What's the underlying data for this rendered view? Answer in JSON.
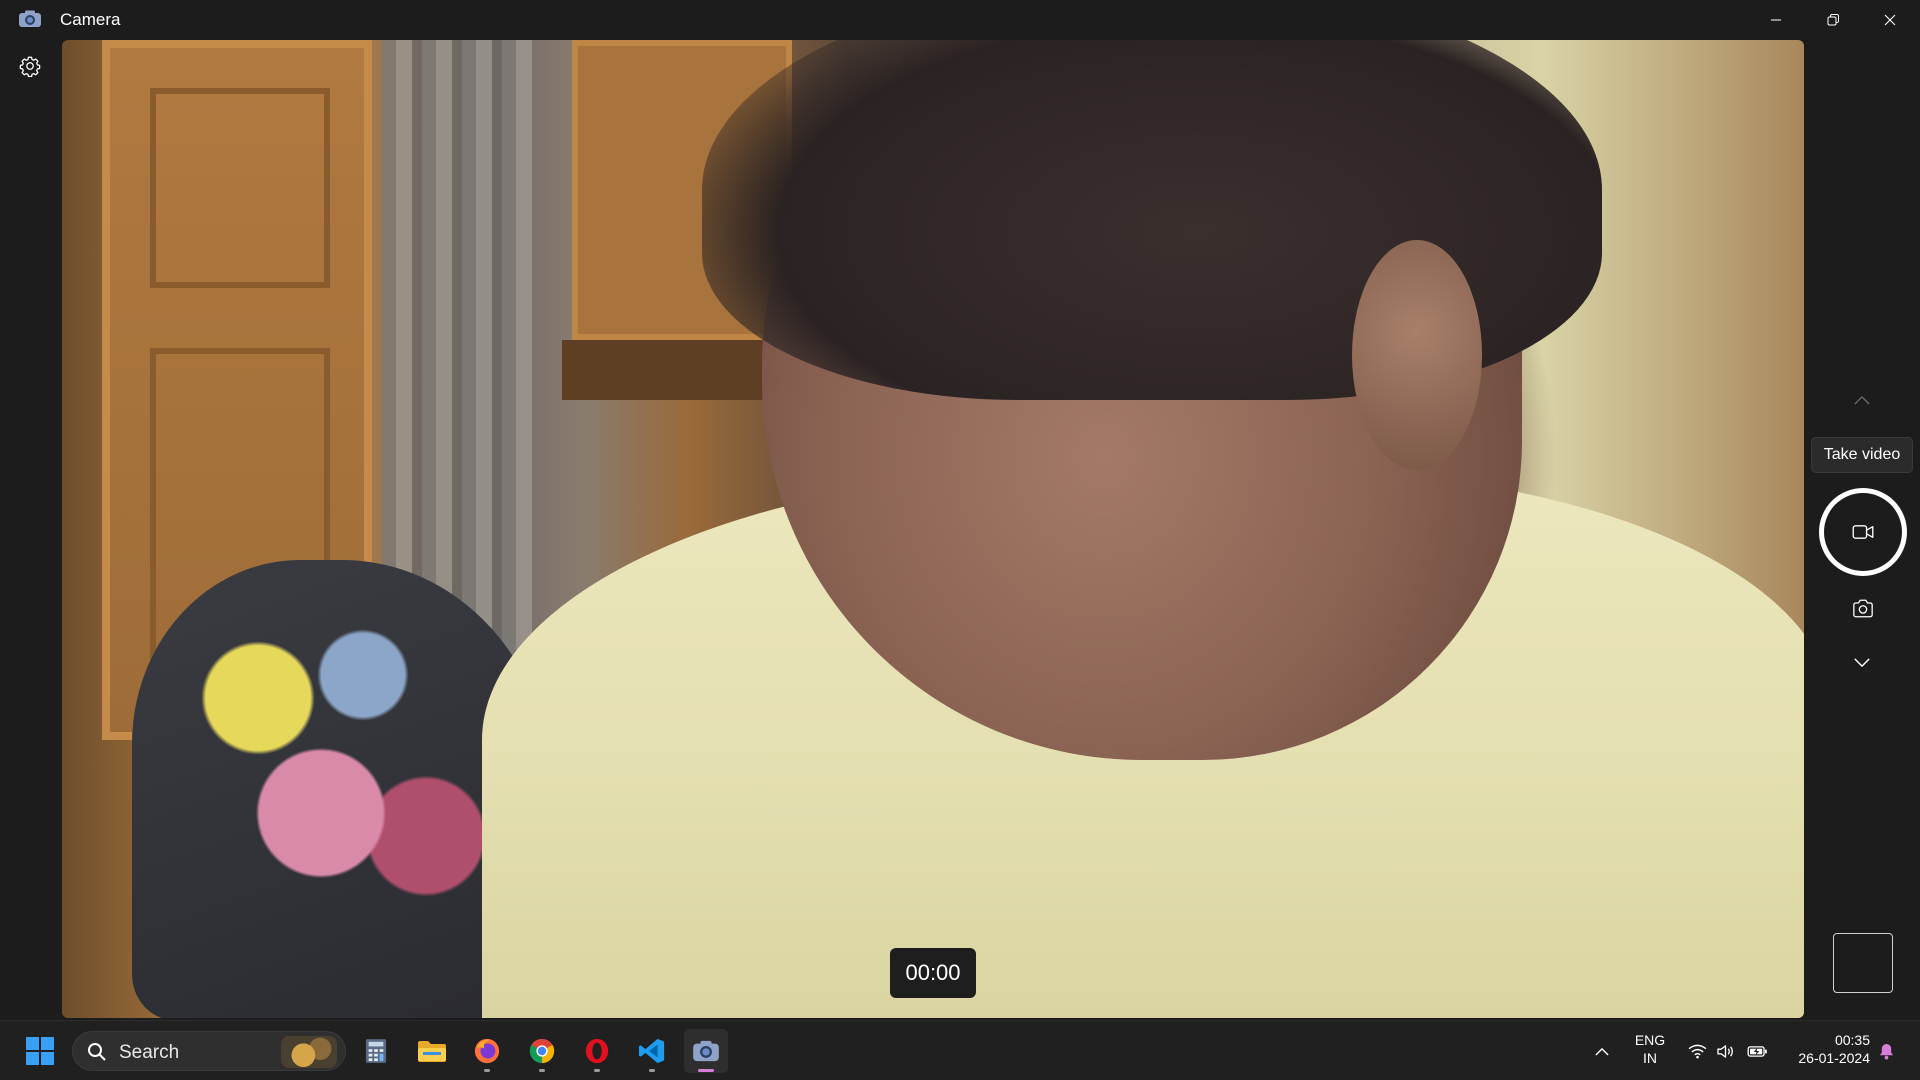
{
  "window": {
    "title": "Camera"
  },
  "viewfinder": {
    "timer": "00:00"
  },
  "controls": {
    "tooltip": "Take video",
    "active_mode": "video"
  },
  "taskbar": {
    "search_label": "Search",
    "apps": [
      {
        "name": "Calculator",
        "icon": "calculator-icon"
      },
      {
        "name": "File Explorer",
        "icon": "folder-icon"
      },
      {
        "name": "Firefox",
        "icon": "firefox-icon"
      },
      {
        "name": "Google Chrome",
        "icon": "chrome-icon"
      },
      {
        "name": "Opera",
        "icon": "opera-icon"
      },
      {
        "name": "Visual Studio Code",
        "icon": "vscode-icon"
      },
      {
        "name": "Camera",
        "icon": "camera-icon"
      }
    ],
    "tray": {
      "language_line1": "ENG",
      "language_line2": "IN",
      "time": "00:35",
      "date": "26-01-2024"
    }
  },
  "colors": {
    "background": "#1c1c1c",
    "taskbar": "#202020",
    "active_indicator": "#d67ed8",
    "shutter_ring": "#ffffff"
  }
}
